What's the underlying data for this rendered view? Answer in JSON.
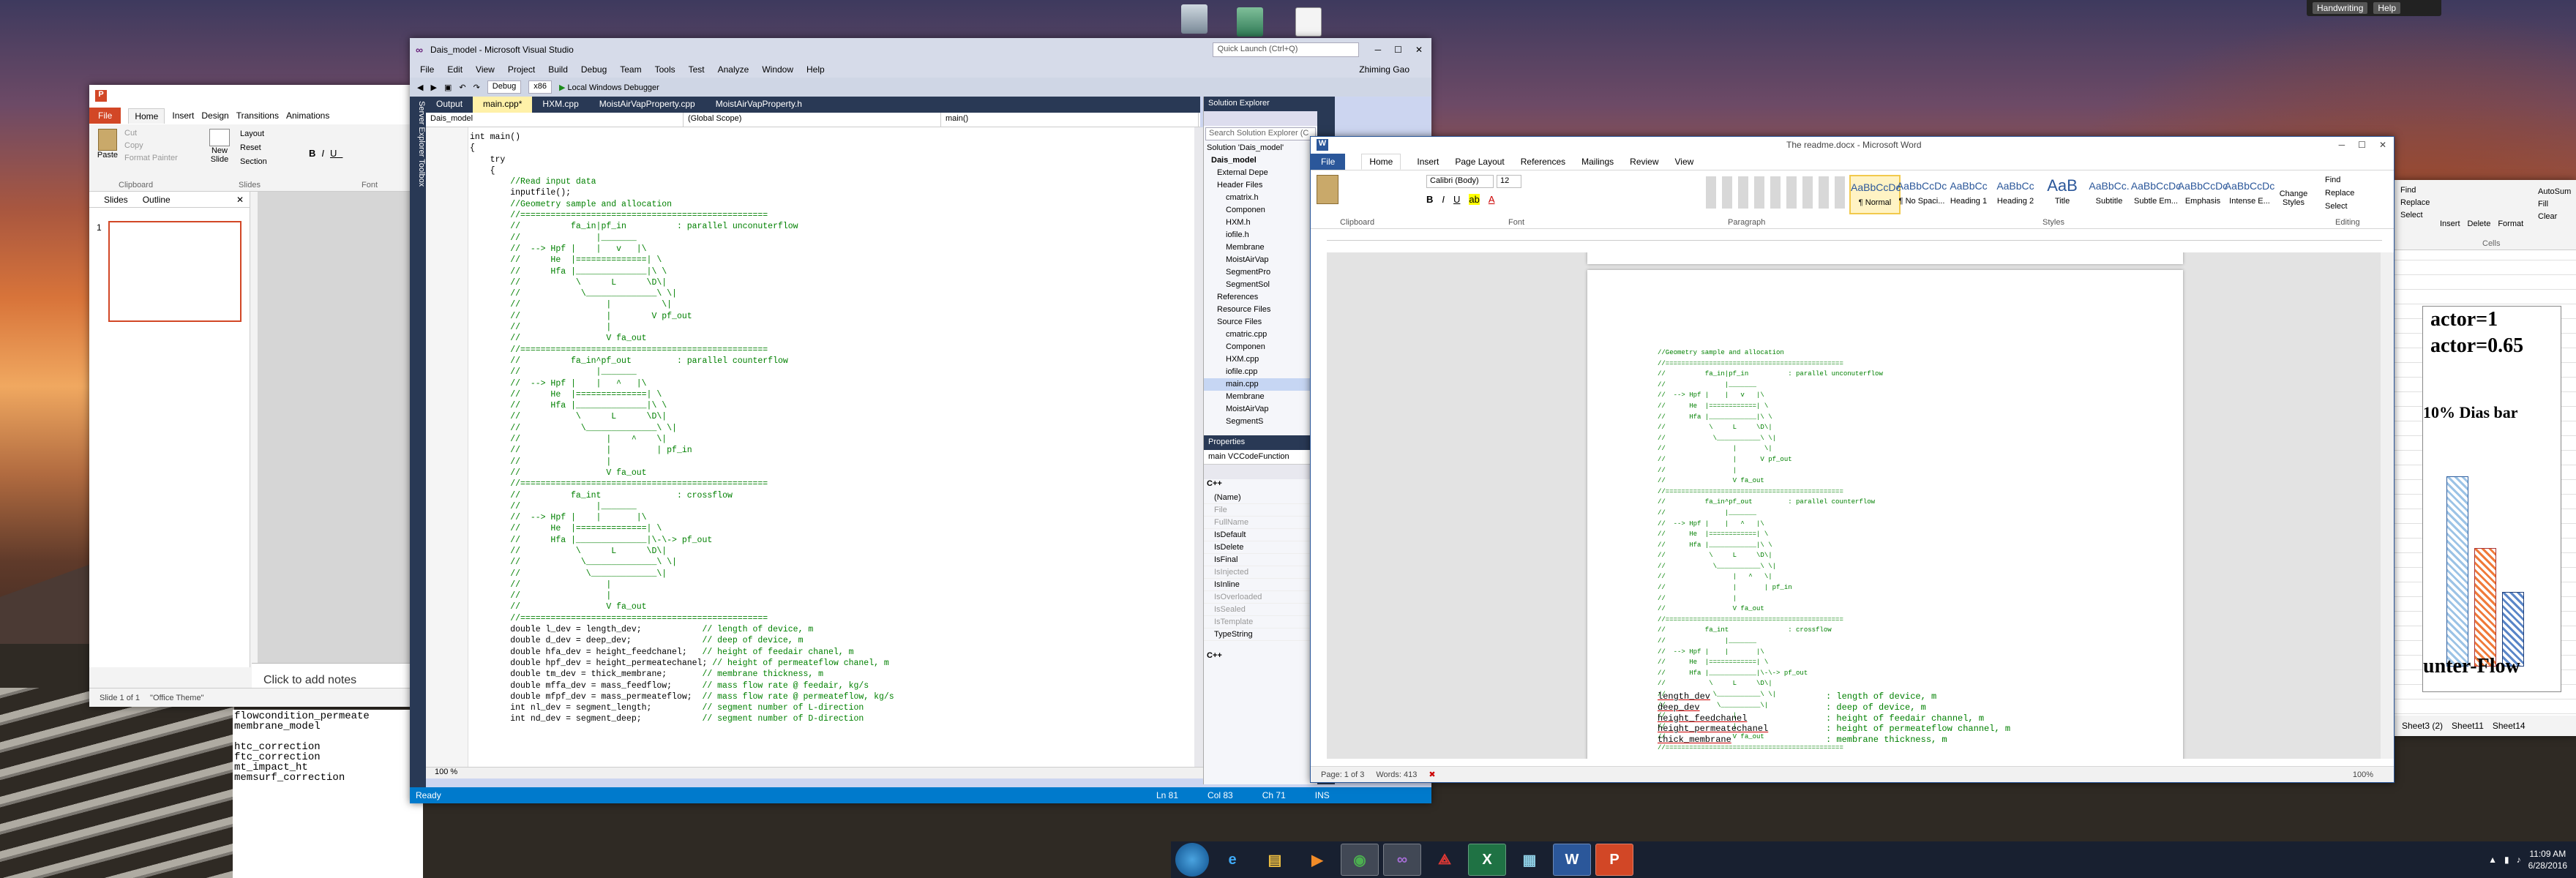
{
  "desktop": {
    "handwriting_label": "Handwriting",
    "help_label": "Help"
  },
  "ppt": {
    "tabs": [
      "File",
      "Home",
      "Insert",
      "Design",
      "Transitions",
      "Animations"
    ],
    "ribbon": {
      "paste": "Paste",
      "cut": "Cut",
      "copy": "Copy",
      "format_painter": "Format Painter",
      "clipboard": "Clipboard",
      "new_slide": "New Slide",
      "layout": "Layout",
      "reset": "Reset",
      "section": "Section",
      "slides": "Slides",
      "font": "Font"
    },
    "panel_tabs": [
      "Slides",
      "Outline"
    ],
    "slide_number": "1",
    "notes_placeholder": "Click to add notes",
    "status_slide": "Slide 1 of 1",
    "status_theme": "\"Office Theme\""
  },
  "txtwin": {
    "lines": [
      "flowcondition_permeate",
      "membrane_model",
      "",
      "htc_correction",
      "ftc_correction",
      "mt_impact_ht",
      "memsurf_correction"
    ]
  },
  "vs": {
    "title": "Dais_model - Microsoft Visual Studio",
    "quick_launch": "Quick Launch (Ctrl+Q)",
    "user": "Zhiming Gao",
    "menu": [
      "File",
      "Edit",
      "View",
      "Project",
      "Build",
      "Debug",
      "Team",
      "Tools",
      "Test",
      "Analyze",
      "Window",
      "Help"
    ],
    "toolbar": {
      "config": "Debug",
      "platform": "x86",
      "run": "Local Windows Debugger"
    },
    "side_tabs": "Server Explorer    Toolbox",
    "tabs": [
      "Output",
      "main.cpp*",
      "HXM.cpp",
      "MoistAirVapProperty.cpp",
      "MoistAirVapProperty.h"
    ],
    "nav": [
      "Dais_model",
      "(Global Scope)",
      "main()"
    ],
    "code_lines": [
      "int main()",
      "{",
      "    try",
      "    {",
      "        //Read input data",
      "        inputfile();",
      "",
      "        //Geometry sample and allocation",
      "        //=================================================",
      "        //          fa_in|pf_in          : parallel unconuterflow",
      "        //               |_______",
      "        //  --> Hpf |    |   v   |\\",
      "        //      He  |==============| \\",
      "        //      Hfa |______________|\\ \\",
      "        //           \\      L      \\D\\|",
      "        //            \\______________\\ \\|",
      "        //                 |          \\|",
      "        //                 |        V pf_out",
      "        //                 |",
      "        //                 V fa_out",
      "        //=================================================",
      "        //          fa_in^pf_out         : parallel counterflow",
      "        //               |_______",
      "        //  --> Hpf |    |   ^   |\\",
      "        //      He  |==============| \\",
      "        //      Hfa |______________|\\ \\",
      "        //           \\      L      \\D\\|",
      "        //            \\______________\\ \\|",
      "        //                 |    ^    \\|",
      "        //                 |         | pf_in",
      "        //                 |",
      "        //                 V fa_out",
      "        //=================================================",
      "        //          fa_int               : crossflow",
      "        //               |_______",
      "        //  --> Hpf |    |       |\\",
      "        //      He  |==============| \\",
      "        //      Hfa |______________|\\-\\-> pf_out",
      "        //           \\      L      \\D\\|",
      "        //            \\______________\\ \\|",
      "        //             \\_____________\\|",
      "        //                 |",
      "        //                 |",
      "        //                 V fa_out",
      "        //=================================================",
      "        double l_dev = length_dev;            // length of device, m",
      "        double d_dev = deep_dev;              // deep of device, m",
      "        double hfa_dev = height_feedchanel;   // height of feedair chanel, m",
      "        double hpf_dev = height_permeatechanel; // height of permeateflow chanel, m",
      "        double tm_dev = thick_membrane;       // membrane thickness, m",
      "        double mffa_dev = mass_feedflow;      // mass flow rate @ feedair, kg/s",
      "        double mfpf_dev = mass_permeateflow;  // mass flow rate @ permeateflow, kg/s",
      "        int nl_dev = segment_length;          // segment number of L-direction",
      "        int nd_dev = segment_deep;            // segment number of D-direction"
    ],
    "zoom": "100 %",
    "status": {
      "ready": "Ready",
      "ln": "Ln 81",
      "col": "Col 83",
      "ch": "Ch 71",
      "ins": "INS"
    },
    "solution_explorer": {
      "title": "Solution Explorer",
      "search": "Search Solution Explorer (C",
      "tree": [
        "Solution 'Dais_model'",
        "Dais_model",
        "External Depe",
        "Header Files",
        "cmatrix.h",
        "Componen",
        "HXM.h",
        "iofile.h",
        "Membrane",
        "MoistAirVap",
        "SegmentPro",
        "SegmentSol",
        "References",
        "Resource Files",
        "Source Files",
        "cmatric.cpp",
        "Componen",
        "HXM.cpp",
        "iofile.cpp",
        "main.cpp",
        "Membrane",
        "MoistAirVap",
        "SegmentS"
      ]
    },
    "properties": {
      "title": "Properties",
      "object": "main  VCCodeFunction",
      "category": "C++",
      "rows": [
        "(Name)",
        "File",
        "FullName",
        "IsDefault",
        "IsDelete",
        "IsFinal",
        "IsInjected",
        "IsInline",
        "IsOverloaded",
        "IsSealed",
        "IsTemplate",
        "TypeString"
      ],
      "footer": "C++"
    }
  },
  "word": {
    "title": "The readme.docx - Microsoft Word",
    "tabs": [
      "File",
      "Home",
      "Insert",
      "Page Layout",
      "References",
      "Mailings",
      "Review",
      "View"
    ],
    "font_name": "Calibri (Body)",
    "font_size": "12",
    "groups": [
      "Clipboard",
      "Font",
      "Paragraph",
      "Styles",
      "Editing"
    ],
    "styles": [
      {
        "sample": "AaBbCcDc",
        "name": "¶ Normal"
      },
      {
        "sample": "AaBbCcDc",
        "name": "¶ No Spaci..."
      },
      {
        "sample": "AaBbCc",
        "name": "Heading 1"
      },
      {
        "sample": "AaBbCc",
        "name": "Heading 2"
      },
      {
        "sample": "AaB",
        "name": "Title"
      },
      {
        "sample": "AaBbCc.",
        "name": "Subtitle"
      },
      {
        "sample": "AaBbCcDc",
        "name": "Subtle Em..."
      },
      {
        "sample": "AaBbCcDc",
        "name": "Emphasis"
      },
      {
        "sample": "AaBbCcDc",
        "name": "Intense E..."
      }
    ],
    "editing": [
      "Find",
      "Replace",
      "Select"
    ],
    "change_styles": "Change Styles",
    "doc_lines": [
      "//Geometry sample and allocation",
      "//=============================================",
      "//          fa_in|pf_in          : parallel unconuterflow",
      "//               |_______",
      "//  --> Hpf |    |   v   |\\",
      "//      He  |============| \\",
      "//      Hfa |____________|\\ \\",
      "//           \\     L     \\D\\|",
      "//            \\___________\\ \\|",
      "//                 |       \\|",
      "//                 |      V pf_out",
      "//                 |",
      "//                 V fa_out",
      "//=============================================",
      "//          fa_in^pf_out         : parallel counterflow",
      "//               |_______",
      "//  --> Hpf |    |   ^   |\\",
      "//      He  |============| \\",
      "//      Hfa |____________|\\ \\",
      "//           \\     L     \\D\\|",
      "//            \\___________\\ \\|",
      "//                 |   ^   \\|",
      "//                 |       | pf_in",
      "//                 |",
      "//                 V fa_out",
      "//=============================================",
      "//          fa_int               : crossflow",
      "//               |_______",
      "//  --> Hpf |    |       |\\",
      "//      He  |============| \\",
      "//      Hfa |____________|\\-\\-> pf_out",
      "//           \\     L     \\D\\|",
      "//            \\___________\\ \\|",
      "//             \\__________\\|",
      "//                 |",
      "//                 |",
      "//                 V fa_out",
      "//============================================="
    ],
    "params": [
      {
        "name": "length_dev",
        "comment": ": length of device, m"
      },
      {
        "name": "deep_dev",
        "comment": ": deep of device, m"
      },
      {
        "name": "height_feedchanel",
        "comment": ": height of feedair channel, m"
      },
      {
        "name": "height_permeatechanel",
        "comment": ": height of permeateflow channel, m"
      },
      {
        "name": "thick_membrane",
        "comment": ": membrane thickness, m"
      }
    ],
    "status_page": "Page: 1 of 3",
    "status_words": "Words: 413",
    "zoom": "100%"
  },
  "excel": {
    "ribbon": [
      "Find",
      "Replace",
      "Select",
      "Insert",
      "Delete",
      "Format",
      "AutoSum",
      "Fill",
      "Clear"
    ],
    "group_cells": "Cells",
    "sheet_tabs": [
      "Sheet3 (2)",
      "Sheet11",
      "Sheet14"
    ],
    "chart_texts": [
      "actor=1",
      "actor=0.65",
      "10% Dias bar",
      "unter-Flow"
    ]
  },
  "taskbar": {
    "apps": [
      "IE",
      "Explorer",
      "Media",
      "Chrome",
      "VS",
      "Acrobat",
      "Excel",
      "Files",
      "Word",
      "PowerPoint"
    ],
    "time": "11:09 AM",
    "date": "6/28/2016"
  }
}
